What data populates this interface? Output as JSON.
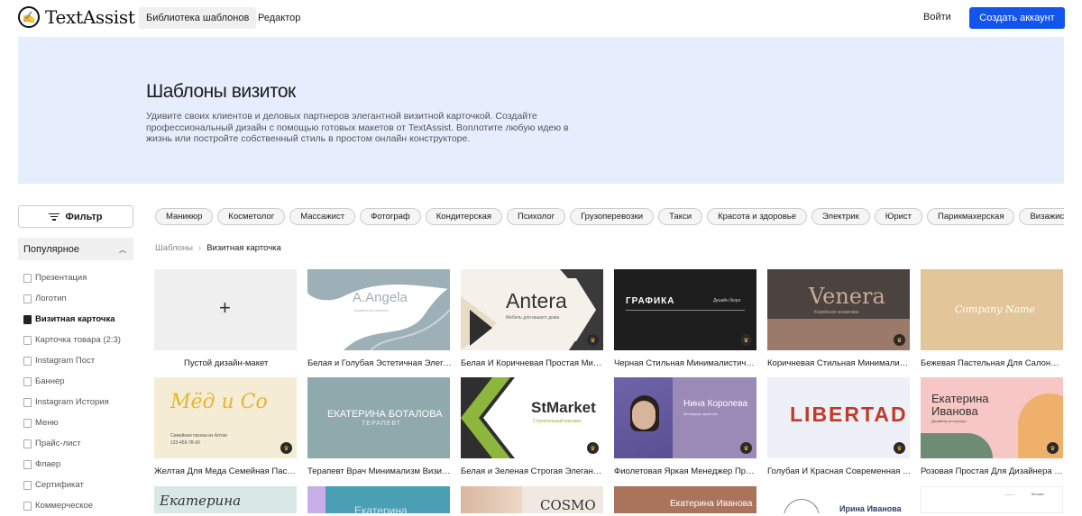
{
  "header": {
    "logo_text": "TextAssist",
    "nav": [
      "Библиотека шаблонов",
      "Редактор"
    ],
    "login": "Войти",
    "signup": "Создать аккаунт"
  },
  "hero": {
    "title": "Шаблоны визиток",
    "description": "Удивите своих клиентов и деловых партнеров элегантной визитной карточкой. Создайте профессиональный дизайн с помощью готовых макетов от TextAssist. Воплотите любую идею в жизнь или постройте собственный стиль в простом онлайн конструкторе."
  },
  "sidebar": {
    "filter_label": "Фильтр",
    "popular_label": "Популярное",
    "items": [
      "Презентация",
      "Логотип",
      "Визитная карточка",
      "Карточка товара (2:3)",
      "Instagram Пост",
      "Баннер",
      "Instagram История",
      "Меню",
      "Прайс-лист",
      "Флаер",
      "Сертификат",
      "Коммерческое"
    ],
    "active_index": 2
  },
  "chips": [
    "Маникюр",
    "Косметолог",
    "Массажист",
    "Фотограф",
    "Кондитерская",
    "Психолог",
    "Грузоперевозки",
    "Такси",
    "Красота и здоровье",
    "Электрик",
    "Юрист",
    "Парикмахерская",
    "Визажист"
  ],
  "breadcrumb": [
    "Шаблоны",
    "Визитная карточка"
  ],
  "cards": {
    "blank": "Пустой дизайн-макет",
    "c1": {
      "title": "Белая и Голубая Эстетичная Элегантная Визитка",
      "name": "A.Angela",
      "sub": "Косметолог-эстетист"
    },
    "c2": {
      "title": "Белая И Коричневая Простая Минималистичная Визитка",
      "name": "Antera",
      "sub": "Мебель для вашего дома"
    },
    "c3": {
      "title": "Черная Стильная Минималистичная Визитка",
      "name": "ГРАФИКА",
      "sub": "Дизайн бюро"
    },
    "c4": {
      "title": "Коричневая Стильная Минималистичная Визитка",
      "name": "Venera",
      "sub": "Корейская косметика"
    },
    "c5": {
      "title": "Бежевая Пастельная Для Салона Красоты Визитка",
      "name": "Company Name"
    },
    "c6": {
      "title": "Желтая Для Меда Семейная Пасека Визитка",
      "name": "Мёд и Со",
      "sub": "Семейная пасека из Алтая",
      "phone": "123-456-78-90"
    },
    "c7": {
      "title": "Терапевт Врач Минимализм Визитка",
      "name": "ЕКАТЕРИНА БОТАЛОВА",
      "sub": "ТЕРАПЕВТ"
    },
    "c8": {
      "title": "Белая и Зеленая Строгая Элегантная Визитка",
      "name": "StMarket",
      "sub": "Строительный магазин"
    },
    "c9": {
      "title": "Фиолетовая Яркая Менеджер Проектов Визитка",
      "name": "Нина Королева",
      "sub": "Менеджер проектов"
    },
    "c10": {
      "title": "Голубая И Красная Современная Минималистичная Визитка",
      "name": "LIBERTAD"
    },
    "c11": {
      "title": "Розовая Простая Для Дизайнера Интерьера Визитка",
      "name1": "Екатерина",
      "name2": "Иванова",
      "sub": "Дизайнер интерьера"
    },
    "r3": {
      "a": "Екатерина",
      "b": "Екатерина",
      "c": "COSMO",
      "d": "Екатерина Иванова",
      "e": "Ирина Иванова",
      "f": "Москва"
    }
  }
}
